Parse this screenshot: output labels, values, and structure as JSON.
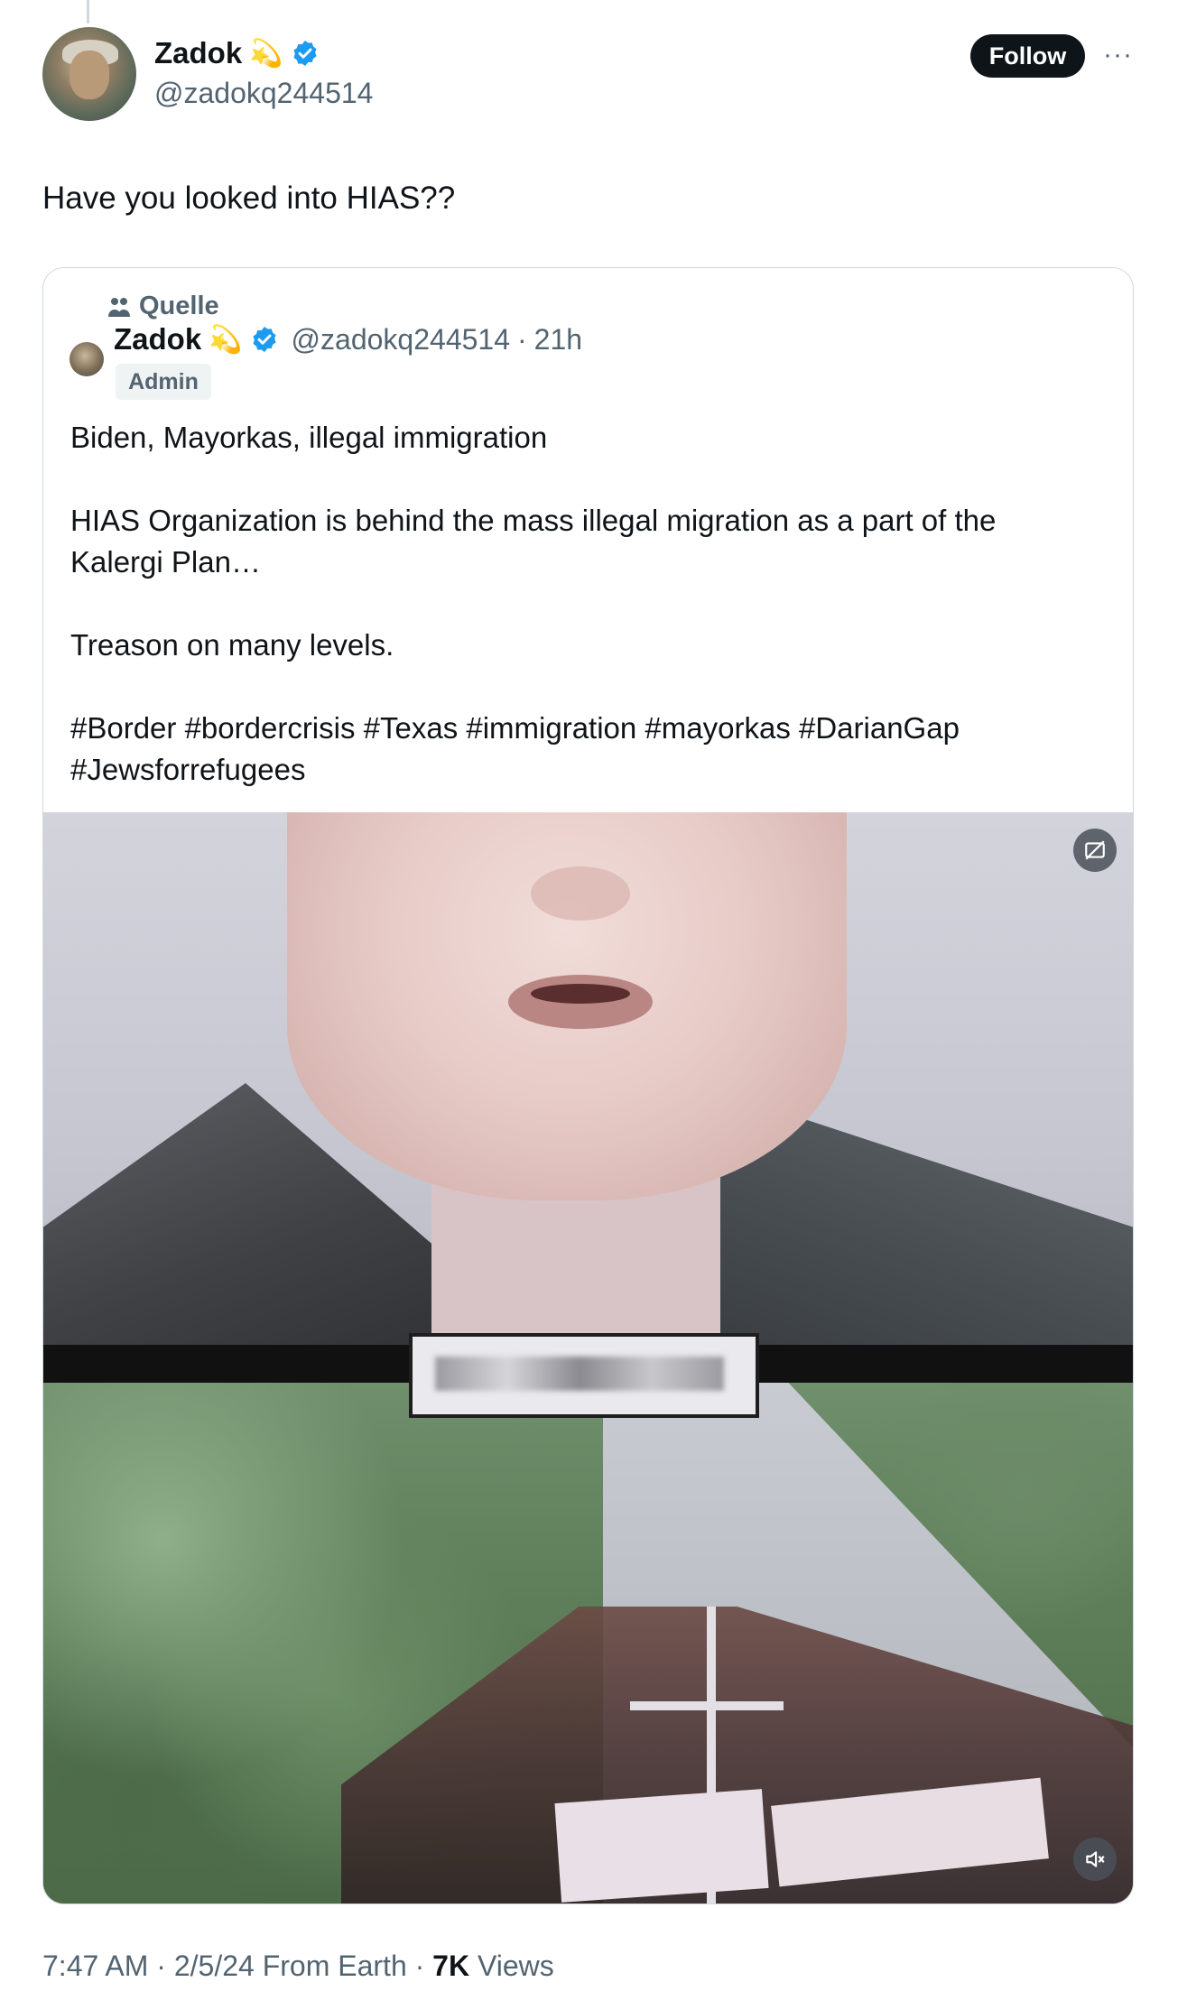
{
  "post": {
    "author_name": "Zadok",
    "author_emoji": "💫",
    "author_handle": "@zadokq244514",
    "follow_label": "Follow",
    "more_label": "···",
    "text": "Have you looked into HIAS??"
  },
  "quote": {
    "community_icon": "community-icon",
    "community_label": "Quelle",
    "author_name": "Zadok",
    "author_emoji": "💫",
    "author_handle": "@zadokq244514",
    "separator": "·",
    "time": "21h",
    "badge": "Admin",
    "paragraphs": [
      "Biden, Mayorkas, illegal immigration",
      "HIAS Organization is behind the mass illegal migration as a part of the Kalergi Plan…",
      "Treason on many levels.",
      "#Border #bordercrisis #Texas #immigration #mayorkas #DarianGap #Jewsforrefugees"
    ],
    "media": {
      "type": "video",
      "top_icon": "gif-off-icon",
      "bottom_icon": "mute-icon"
    }
  },
  "footer": {
    "time": "7:47 AM",
    "separator": "·",
    "date": "2/5/24",
    "source": "From Earth",
    "views_count": "7K",
    "views_label": "Views"
  },
  "colors": {
    "verified": "#1d9bf0",
    "secondary_text": "#536471",
    "primary_text": "#0f1419",
    "border": "#cfd9de"
  }
}
